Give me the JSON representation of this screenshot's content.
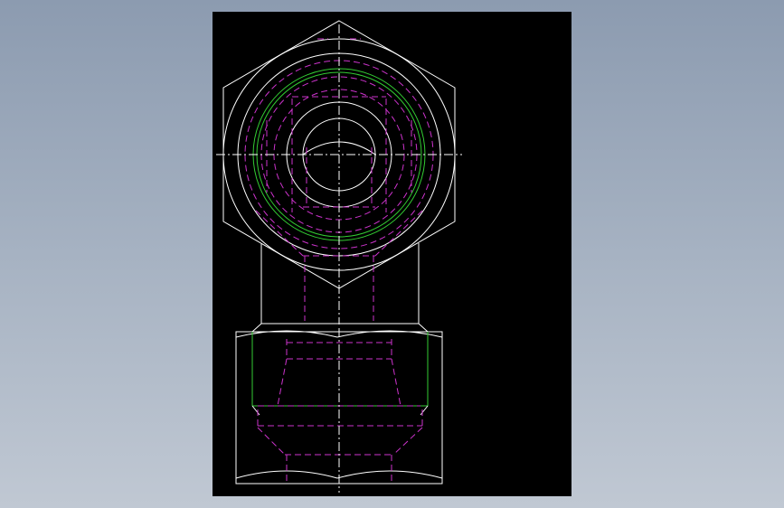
{
  "canvas": {
    "background": "#000000",
    "colors": {
      "outline": "#ffffff",
      "hidden_line": "#cc33cc",
      "thread": "#33cc33",
      "centerline": "#ffffff"
    },
    "line_styles": {
      "outline": "solid",
      "hidden_line": "dashed",
      "centerline": "dash-dot"
    }
  },
  "drawing": {
    "views": [
      {
        "id": "top-view",
        "content": "hex-nut-end-view"
      },
      {
        "id": "front-view",
        "content": "fitting-side-view"
      }
    ]
  }
}
